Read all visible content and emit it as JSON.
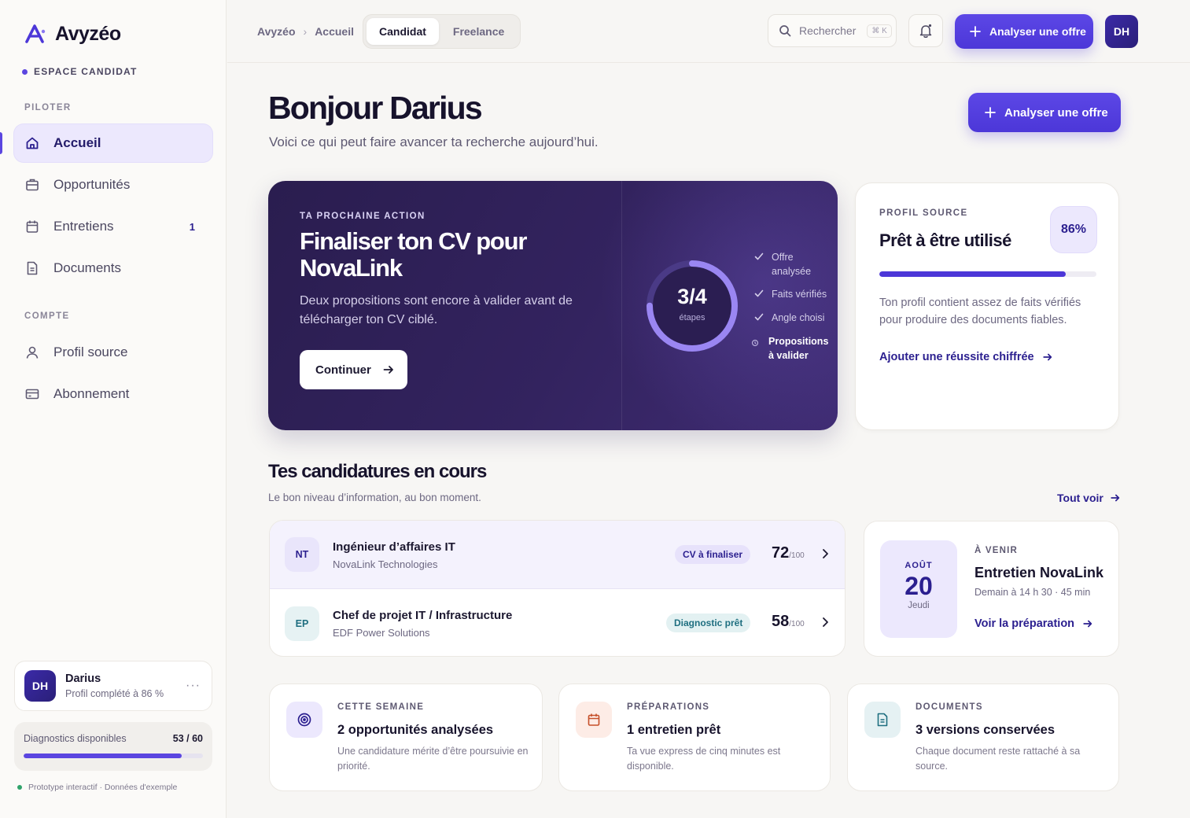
{
  "brand": {
    "name": "Avyzéo",
    "space": "ESPACE CANDIDAT",
    "accent": "#5b46e0"
  },
  "sidebar": {
    "section_pilot": "PILOTER",
    "section_account": "COMPTE",
    "items": [
      {
        "label": "Accueil",
        "icon": "home-icon",
        "active": true
      },
      {
        "label": "Opportunités",
        "icon": "briefcase-icon"
      },
      {
        "label": "Entretiens",
        "icon": "calendar-icon",
        "badge": "1"
      },
      {
        "label": "Documents",
        "icon": "document-icon"
      },
      {
        "label": "Profil source",
        "icon": "user-icon"
      },
      {
        "label": "Abonnement",
        "icon": "credit-card-icon"
      }
    ],
    "user": {
      "initials": "DH",
      "name": "Darius",
      "sub": "Profil complété à 86 %",
      "more": "···"
    },
    "diagnostics": {
      "label": "Diagnostics disponibles",
      "value": "53 / 60",
      "used": 53,
      "total": 60
    },
    "footer": "Prototype interactif · Données d'exemple"
  },
  "topbar": {
    "crumbs": [
      "Avyzéo",
      "Accueil"
    ],
    "tabs": [
      "Candidat",
      "Freelance"
    ],
    "search": {
      "label": "Rechercher",
      "shortcut": "⌘ K"
    },
    "cta": "Analyser une offre",
    "avatar": "DH"
  },
  "main": {
    "greeting": "Bonjour Darius",
    "subtitle": "Voici ce qui peut faire avancer ta recherche aujourd’hui.",
    "cta": "Analyser une offre",
    "hero": {
      "kicker": "TA PROCHAINE ACTION",
      "title": "Finaliser ton CV pour NovaLink",
      "text": "Deux propositions sont encore à valider avant de télécharger ton CV ciblé.",
      "button": "Continuer",
      "progress_value": "3/4",
      "progress_label": "étapes",
      "progress_done": 3,
      "progress_total": 4,
      "steps": [
        {
          "label": "Offre analysée",
          "done": true
        },
        {
          "label": "Faits vérifiés",
          "done": true
        },
        {
          "label": "Angle choisi",
          "done": true
        },
        {
          "label": "Propositions à valider",
          "done": false
        }
      ]
    },
    "profile": {
      "kicker": "PROFIL SOURCE",
      "title": "Prêt à être utilisé",
      "percent": "86%",
      "percent_value": 86,
      "text": "Ton profil contient assez de faits vérifiés pour produire des documents fiables.",
      "link": "Ajouter une réussite chiffrée"
    },
    "applications": {
      "title": "Tes candidatures en cours",
      "subtitle": "Le bon niveau d’information, au bon moment.",
      "see_all": "Tout voir",
      "rows": [
        {
          "initials": "NT",
          "title": "Ingénieur d’affaires IT",
          "company": "NovaLink Technologies",
          "status": "CV à finaliser",
          "score": "72",
          "max": "/100"
        },
        {
          "initials": "EP",
          "title": "Chef de projet IT / Infrastructure",
          "company": "EDF Power Solutions",
          "status": "Diagnostic prêt",
          "score": "58",
          "max": "/100"
        }
      ]
    },
    "interview": {
      "month": "AOÛT",
      "day": "20",
      "weekday": "Jeudi",
      "kicker": "À VENIR",
      "title": "Entretien NovaLink",
      "sub": "Demain à 14 h 30 · 45 min",
      "link": "Voir la préparation"
    },
    "stats": [
      {
        "icon": "target-icon",
        "kicker": "CETTE SEMAINE",
        "title": "2 opportunités analysées",
        "text": "Une candidature mérite d’être poursuivie en priorité."
      },
      {
        "icon": "calendar-icon",
        "kicker": "PRÉPARATIONS",
        "title": "1 entretien prêt",
        "text": "Ta vue express de cinq minutes est disponible."
      },
      {
        "icon": "document-icon",
        "kicker": "DOCUMENTS",
        "title": "3 versions conservées",
        "text": "Chaque document reste rattaché à sa source."
      }
    ]
  }
}
